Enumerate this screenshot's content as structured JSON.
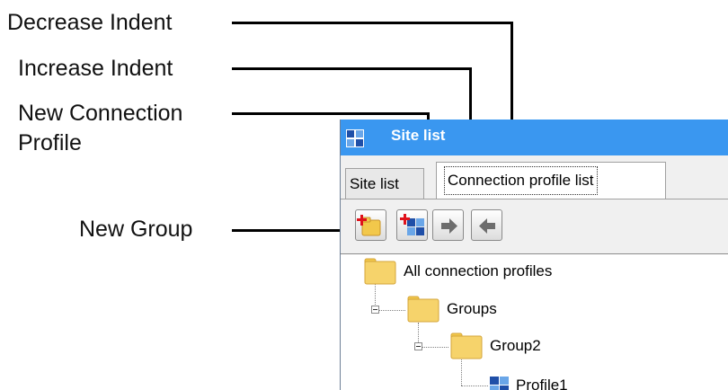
{
  "callouts": {
    "decrease_indent": "Decrease Indent",
    "increase_indent": "Increase Indent",
    "new_connection_profile_line1": "New Connection",
    "new_connection_profile_line2": "Profile",
    "new_group": "New Group"
  },
  "window": {
    "title": "Site list",
    "tabs": [
      {
        "label": "Site list",
        "active": false
      },
      {
        "label": "Connection profile list",
        "active": true
      }
    ],
    "toolbar": [
      {
        "icon": "new-group-icon"
      },
      {
        "icon": "new-connection-profile-icon"
      },
      {
        "icon": "increase-indent-icon"
      },
      {
        "icon": "decrease-indent-icon"
      }
    ],
    "tree": {
      "root": "All connection profiles",
      "group": "Groups",
      "subgroup": "Group2",
      "profile": "Profile1"
    }
  },
  "colors": {
    "titlebar": "#3a97f0",
    "folder": "#f2c84b",
    "plus": "#e0121b"
  }
}
